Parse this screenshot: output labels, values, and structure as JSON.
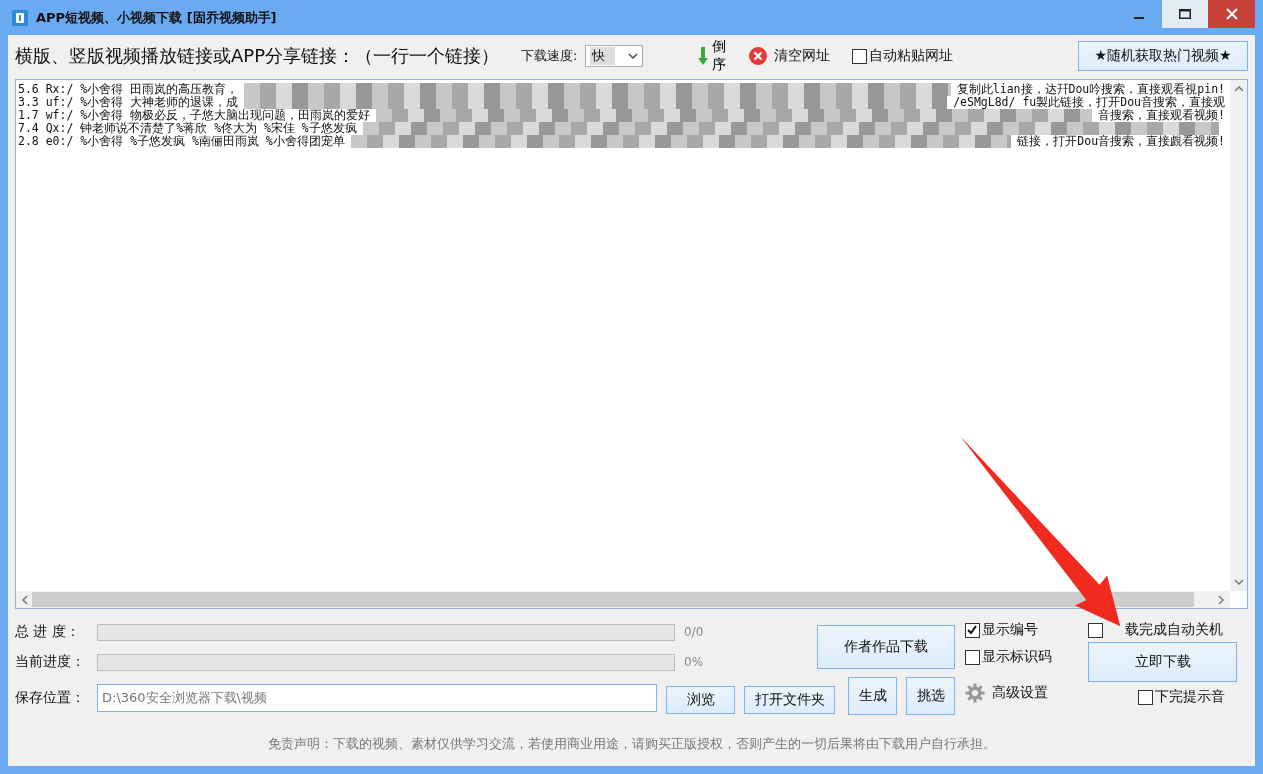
{
  "window": {
    "title": "APP短视频、小视频下载 [固乔视频助手]"
  },
  "toolbar": {
    "label": "横版、竖版视频播放链接或APP分享链接：（一行一个链接）",
    "speed_label": "下载速度:",
    "speed_value": "快",
    "reverse_button": "倒序",
    "clear_button": "清空网址",
    "auto_paste": {
      "label": "自动粘贴网址",
      "checked": false
    },
    "random_button": "★随机获取热门视频★"
  },
  "links": [
    {
      "left": "5.6 Rx:/ %小舍得 田雨岚的高压教育，",
      "right": "复制此lian接，达幵Dou吟搜索，直接观看視pin!"
    },
    {
      "left": "3.3 uf:/ %小舍得 大神老师的退课，成",
      "right": "/eSMgL8d/ fu製此链接，打开Dou音搜索，直接观"
    },
    {
      "left": "1.7 wf:/ %小舍得  物极必反，子悠大脑出现问题，田雨岚的爱好",
      "right": "音搜索，直接观看视频!"
    },
    {
      "left": "7.4 Qx:/ 钟老师说不清楚了%蒋欣 %佟大为 %宋佳 %子悠发疯"
    },
    {
      "left": "2.8 e0:/ %小舍得 %子悠发疯 %南俪田雨岚 %小舍得团宠单",
      "right": "链接，打开Dou音搜索，直接覰看视频!"
    }
  ],
  "progress": [
    {
      "label": "总 进 度：",
      "reading": "0/0",
      "level": 0
    },
    {
      "label": "当前进度：",
      "reading": "0%",
      "level": 0
    }
  ],
  "save": {
    "label": "保存位置：",
    "value": "D:\\360安全浏览器下载\\视频"
  },
  "buttons": {
    "browse": "浏览",
    "open_folder": "打开文件夹",
    "generate": "生成",
    "pick": "挑选",
    "author_download": "作者作品下载",
    "download_now": "立即下载",
    "advanced": "高级设置"
  },
  "options": [
    {
      "label": "显示编号",
      "checked": true
    },
    {
      "label": "显示标识码",
      "checked": false
    }
  ],
  "shutdown": {
    "label": "载完成自动关机",
    "checked": false
  },
  "sound": {
    "label": "下完提示音",
    "checked": false
  },
  "disclaimer": "免责声明：下载的视频、素材仅供学习交流，若使用商业用途，请购买正版授权，否则产生的一切后果将由下载用户自行承担。"
}
